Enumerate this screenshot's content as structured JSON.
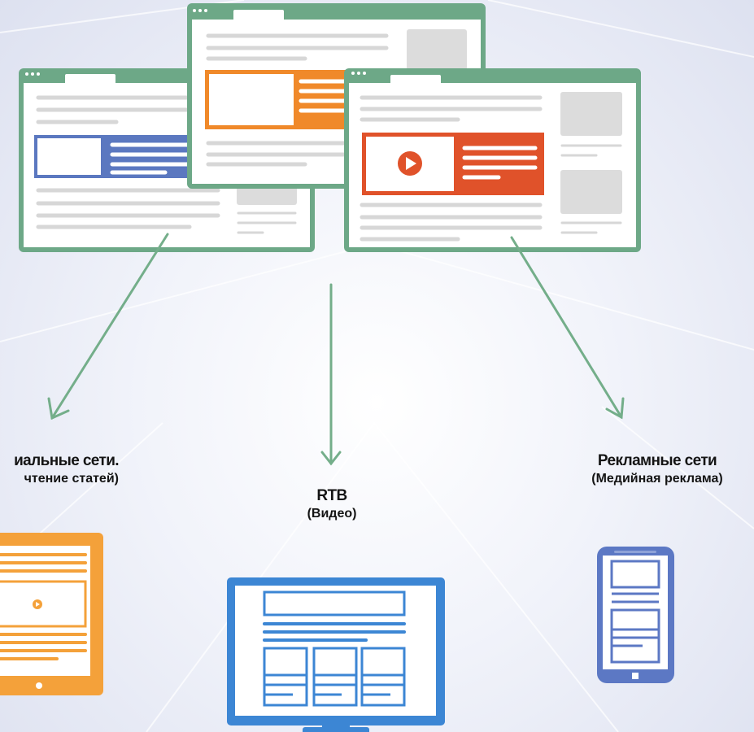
{
  "colors": {
    "browser_frame": "#6da887",
    "arrow": "#74ae8a",
    "line_gray": "#d7d7d7",
    "block_gray": "#dcdcdc",
    "blue_ad": "#5b78c0",
    "orange_ad": "#f0892a",
    "red_ad": "#e0522a",
    "tablet_orange": "#f4a13a",
    "monitor_blue": "#3c86d4",
    "phone_blue": "#5c78c4"
  },
  "channels": [
    {
      "title": "иальные сети.",
      "subtitle": "чтение статей)"
    },
    {
      "title": "RTB",
      "subtitle": "(Видео)"
    },
    {
      "title": "Рекламные сети",
      "subtitle": "(Медийная реклама)"
    }
  ],
  "browsers": [
    {
      "ad": "blue-banner-ad"
    },
    {
      "ad": "orange-banner-ad"
    },
    {
      "ad": "red-video-ad"
    }
  ],
  "devices": [
    "tablet",
    "monitor",
    "smartphone"
  ]
}
